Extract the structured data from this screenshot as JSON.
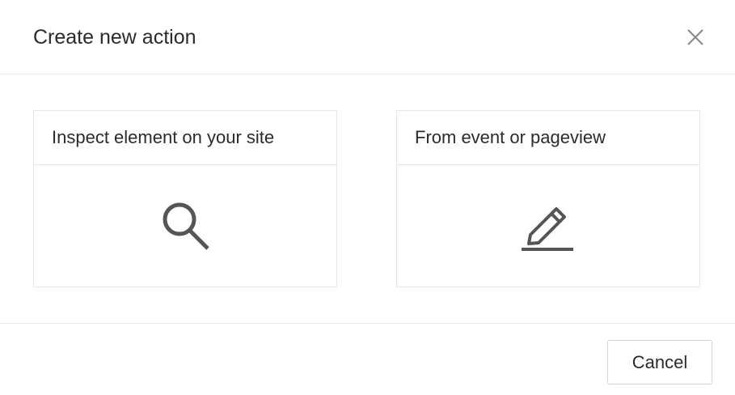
{
  "modal": {
    "title": "Create new action",
    "close_icon": "close-icon"
  },
  "options": [
    {
      "label": "Inspect element on your site",
      "icon": "search-icon"
    },
    {
      "label": "From event or pageview",
      "icon": "pencil-icon"
    }
  ],
  "footer": {
    "cancel_label": "Cancel"
  },
  "colors": {
    "icon": "#555555",
    "border": "#e6e6e6",
    "text": "#2b2b2b"
  }
}
